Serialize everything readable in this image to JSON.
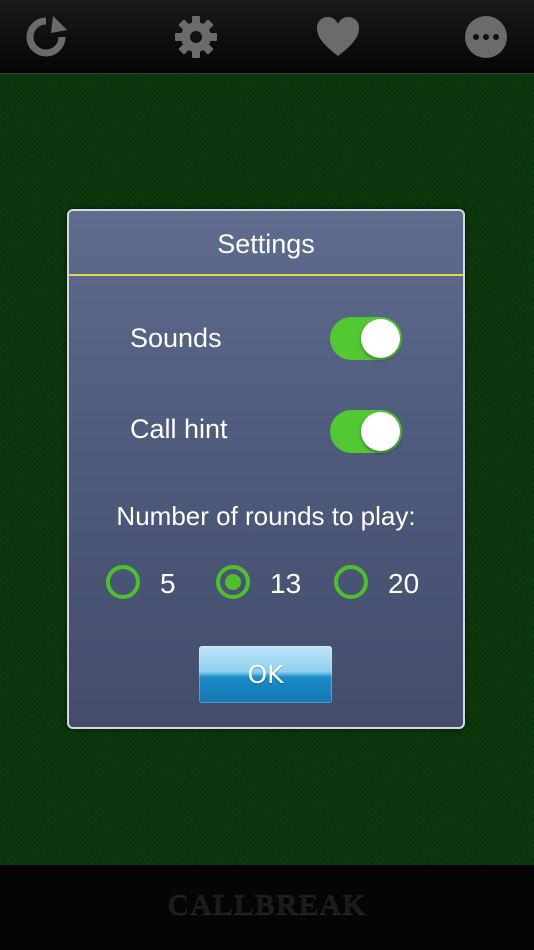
{
  "toolbar": {
    "buttons": [
      {
        "icon": "refresh-icon"
      },
      {
        "icon": "gear-icon"
      },
      {
        "icon": "heart-icon"
      },
      {
        "icon": "more-icon"
      }
    ],
    "icon_color": "#6b6b6b"
  },
  "felt_color": "#0d3a0d",
  "dialog": {
    "title": "Settings",
    "sounds": {
      "label": "Sounds",
      "on": true
    },
    "call_hint": {
      "label": "Call hint",
      "on": true
    },
    "rounds": {
      "label": "Number of rounds to play:",
      "options": [
        "5",
        "13",
        "20"
      ],
      "selected": "13"
    },
    "ok_label": "OK",
    "accent_color": "#52c832",
    "divider_color": "#e5d84a"
  },
  "footer": {
    "brand": "CALLBREAK"
  }
}
